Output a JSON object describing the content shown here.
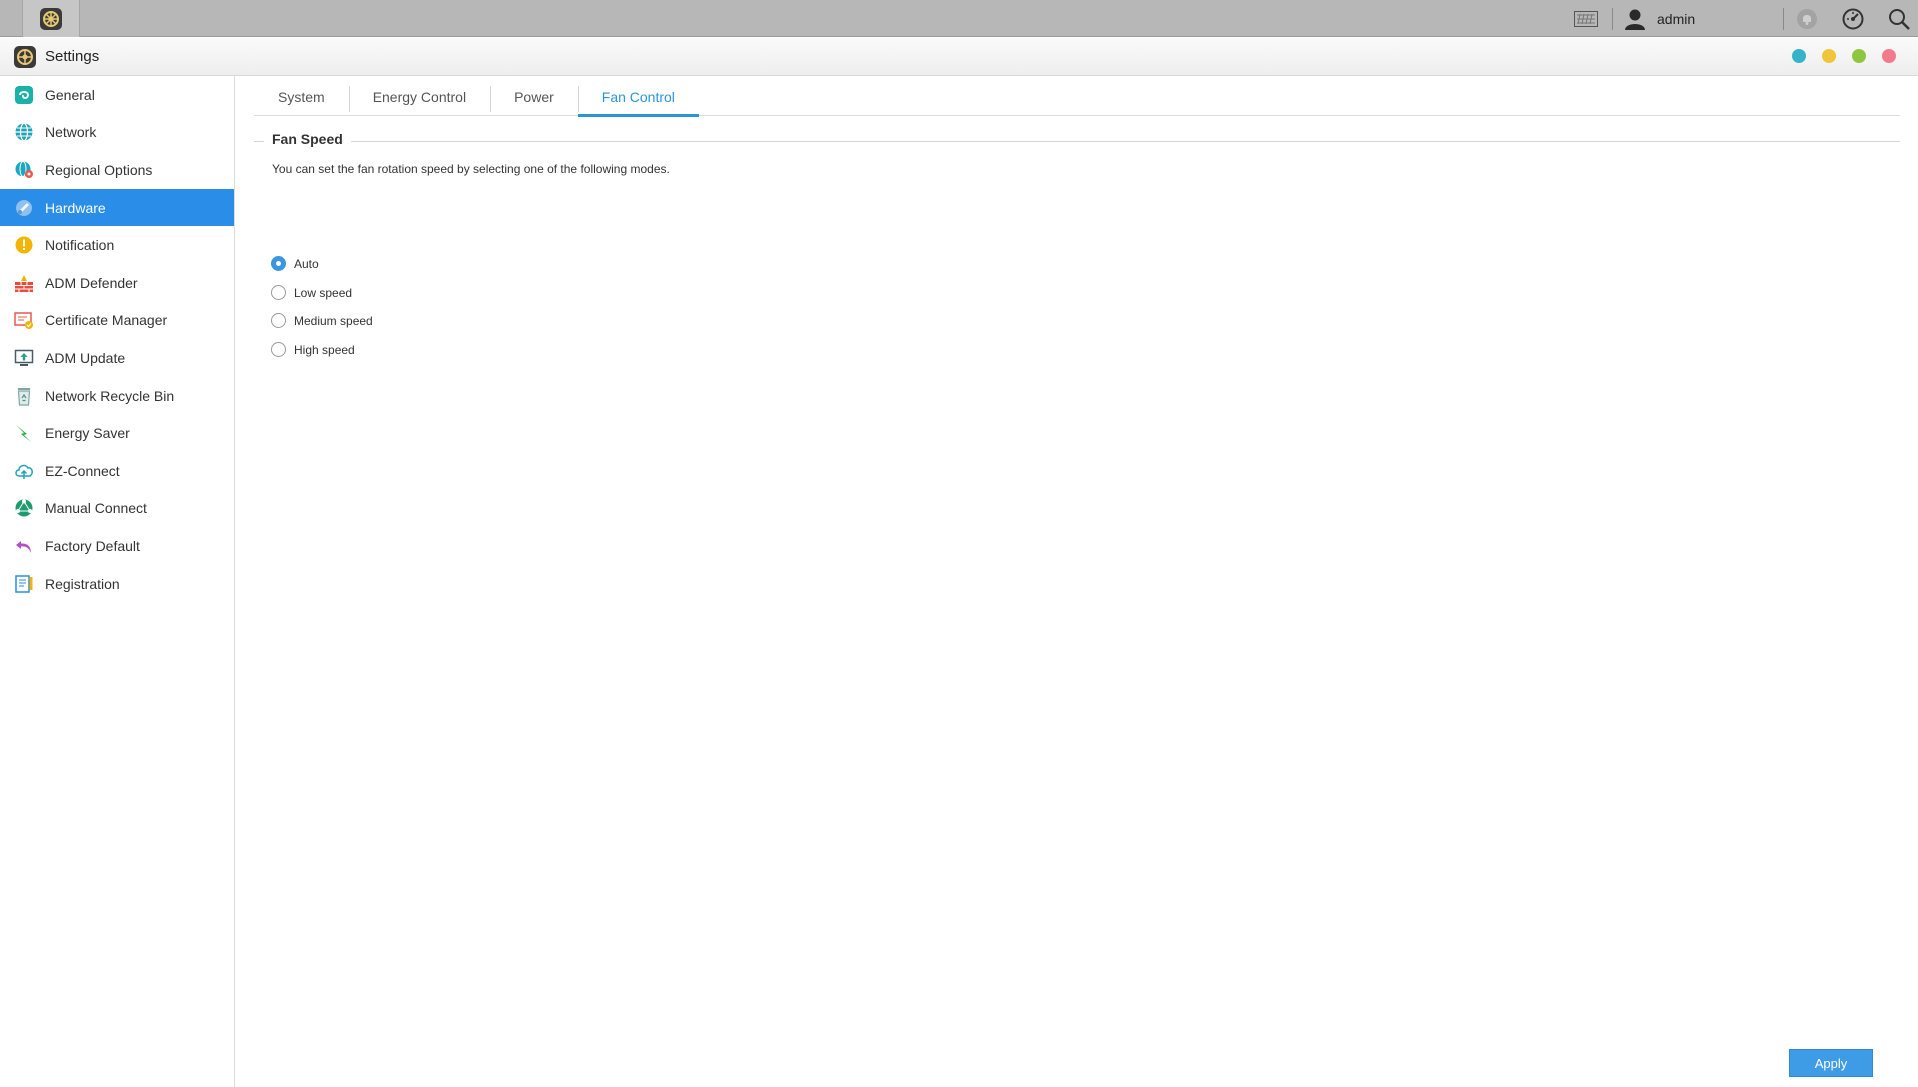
{
  "taskbar": {
    "user": "admin",
    "icons": [
      "settings-app-icon",
      "keyboard-icon",
      "user-icon",
      "notification-icon",
      "dashboard-icon",
      "search-icon"
    ]
  },
  "window": {
    "title": "Settings",
    "controls": [
      {
        "name": "info",
        "color": "#35b3c8"
      },
      {
        "name": "minimize",
        "color": "#f0c53b"
      },
      {
        "name": "maximize",
        "color": "#8ec63f"
      },
      {
        "name": "close",
        "color": "#f27a8a"
      }
    ]
  },
  "sidebar": {
    "items": [
      {
        "label": "General",
        "icon": "general-icon",
        "color": "#19b1a8"
      },
      {
        "label": "Network",
        "icon": "globe-icon",
        "color": "#1fa3b8"
      },
      {
        "label": "Regional Options",
        "icon": "regional-icon",
        "color": "#1aa7c2"
      },
      {
        "label": "Hardware",
        "icon": "hardware-icon",
        "color": "#7fb5e8"
      },
      {
        "label": "Notification",
        "icon": "notification-icon",
        "color": "#f5b400"
      },
      {
        "label": "ADM Defender",
        "icon": "firewall-icon",
        "color": "#e84c3d"
      },
      {
        "label": "Certificate Manager",
        "icon": "certificate-icon",
        "color": "#e8584f"
      },
      {
        "label": "ADM Update",
        "icon": "update-icon",
        "color": "#2a9e8e"
      },
      {
        "label": "Network Recycle Bin",
        "icon": "recycle-bin-icon",
        "color": "#7fa8a3"
      },
      {
        "label": "Energy Saver",
        "icon": "energy-icon",
        "color": "#27b23f"
      },
      {
        "label": "EZ-Connect",
        "icon": "cloud-icon",
        "color": "#1fa3b8"
      },
      {
        "label": "Manual Connect",
        "icon": "manual-connect-icon",
        "color": "#1f9c6e"
      },
      {
        "label": "Factory Default",
        "icon": "undo-icon",
        "color": "#b04fc6"
      },
      {
        "label": "Registration",
        "icon": "registration-icon",
        "color": "#2a8de8"
      }
    ],
    "active_index": 3
  },
  "tabs": [
    {
      "label": "System"
    },
    {
      "label": "Energy Control"
    },
    {
      "label": "Power"
    },
    {
      "label": "Fan Control"
    }
  ],
  "active_tab": 3,
  "fan": {
    "legend": "Fan Speed",
    "description": "You can set the fan rotation speed by selecting one of the following modes.",
    "options": [
      {
        "label": "Auto",
        "checked": true
      },
      {
        "label": "Low speed",
        "checked": false
      },
      {
        "label": "Medium speed",
        "checked": false
      },
      {
        "label": "High speed",
        "checked": false
      }
    ]
  },
  "apply_label": "Apply",
  "colors": {
    "accent": "#2a8de8",
    "tab_accent": "#2a95d8"
  }
}
